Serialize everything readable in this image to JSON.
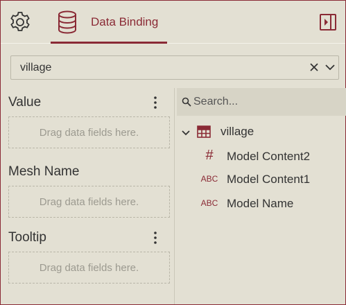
{
  "header": {
    "settings_icon": "gear-icon",
    "tab_label": "Data Binding",
    "tab_icon": "database-icon",
    "panel_icon": "panel-toggle-icon"
  },
  "dataset": {
    "selected": "village"
  },
  "sections": [
    {
      "title": "Value",
      "placeholder": "Drag data fields here."
    },
    {
      "title": "Mesh Name",
      "placeholder": "Drag data fields here."
    },
    {
      "title": "Tooltip",
      "placeholder": "Drag data fields here."
    }
  ],
  "fields_panel": {
    "search_placeholder": "Search...",
    "root": {
      "label": "village",
      "icon": "table-icon"
    },
    "items": [
      {
        "type": "#",
        "label": "Model Content2"
      },
      {
        "type": "ABC",
        "label": "Model Content1"
      },
      {
        "type": "ABC",
        "label": "Model Name"
      }
    ]
  },
  "colors": {
    "accent": "#8a2a35",
    "background": "#e3e0d3"
  }
}
